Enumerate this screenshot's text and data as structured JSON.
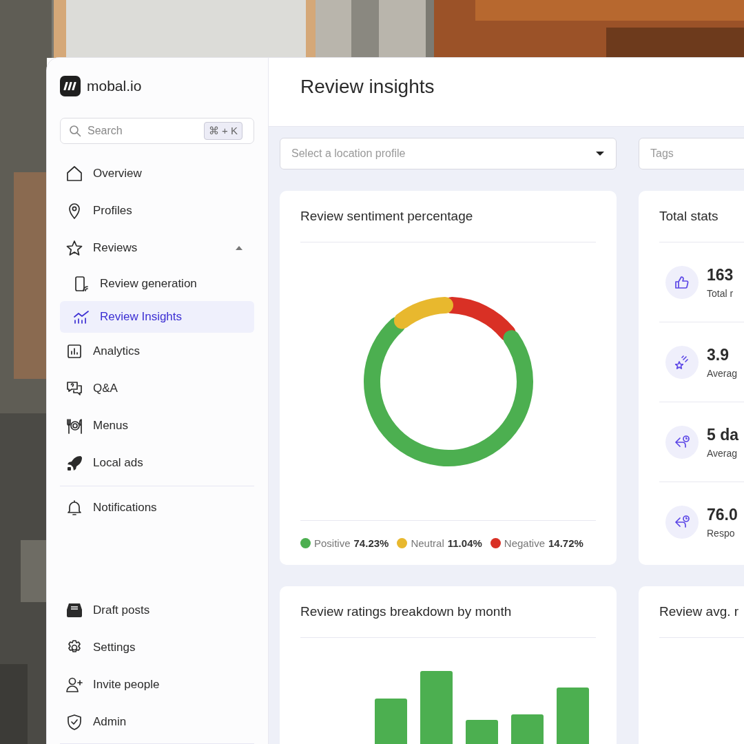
{
  "brand": {
    "name": "mobal.io"
  },
  "search": {
    "placeholder": "Search",
    "shortcut": "⌘ + K"
  },
  "nav_items": [
    {
      "label": "Overview",
      "selected": false
    },
    {
      "label": "Profiles",
      "selected": false
    },
    {
      "label": "Reviews",
      "selected": false,
      "expanded": true,
      "children": [
        {
          "label": "Review generation",
          "selected": false
        },
        {
          "label": "Review Insights",
          "selected": true
        }
      ]
    },
    {
      "label": "Analytics",
      "selected": false
    },
    {
      "label": "Q&A",
      "selected": false
    },
    {
      "label": "Menus",
      "selected": false
    },
    {
      "label": "Local ads",
      "selected": false
    }
  ],
  "notification_items": [
    {
      "label": "Notifications",
      "selected": false
    }
  ],
  "bottom_items": [
    {
      "label": "Draft posts",
      "selected": false
    },
    {
      "label": "Settings",
      "selected": false
    },
    {
      "label": "Invite people",
      "selected": false
    },
    {
      "label": "Admin",
      "selected": false
    }
  ],
  "page_title": "Review insights",
  "filters": {
    "location": {
      "placeholder": "Select a location profile"
    },
    "tags": {
      "placeholder": "Tags"
    }
  },
  "sentiment_card": {
    "title": "Review sentiment percentage",
    "legend": [
      {
        "label": "Positive",
        "value": "74.23%",
        "color": "#4caf50"
      },
      {
        "label": "Neutral",
        "value": "11.04%",
        "color": "#e8b82e"
      },
      {
        "label": "Negative",
        "value": "14.72%",
        "color": "#d93025"
      }
    ]
  },
  "stats_card": {
    "title": "Total stats",
    "rows": [
      {
        "value": "163",
        "label": "Total r"
      },
      {
        "value": "3.9",
        "label": "Averag"
      },
      {
        "value": "5 da",
        "label": "Averag"
      },
      {
        "value": "76.0",
        "label": "Respo"
      }
    ]
  },
  "ratings_card": {
    "title": "Review ratings breakdown by month"
  },
  "avg_card": {
    "title": "Review avg. r"
  }
}
